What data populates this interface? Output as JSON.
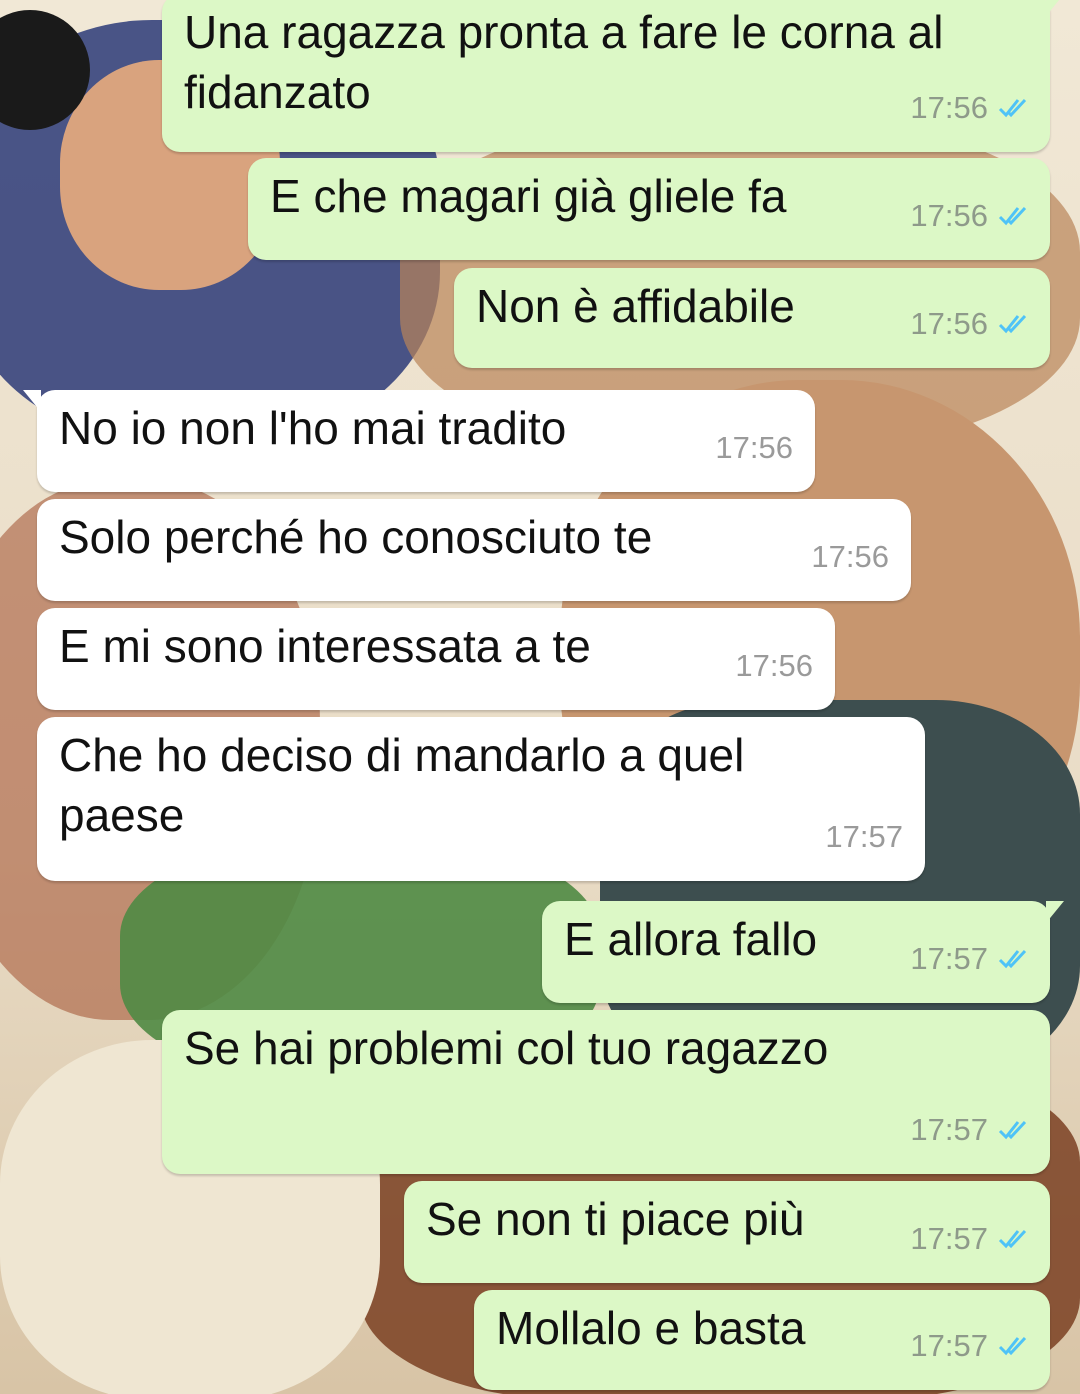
{
  "colors": {
    "outgoing_bubble": "#dcf8c6",
    "incoming_bubble": "#ffffff",
    "read_ticks": "#4fc3f7",
    "timestamp": "#8e9a8a"
  },
  "messages": [
    {
      "direction": "out",
      "text": "Una ragazza pronta a fare le corna al\nfidanzato",
      "time": "17:56",
      "status": "read-double-check-icon"
    },
    {
      "direction": "out",
      "text": "E che magari già gliele fa",
      "time": "17:56",
      "status": "read-double-check-icon"
    },
    {
      "direction": "out",
      "text": "Non è affidabile",
      "time": "17:56",
      "status": "read-double-check-icon"
    },
    {
      "direction": "in",
      "text": "No io non l'ho mai tradito",
      "time": "17:56"
    },
    {
      "direction": "in",
      "text": "Solo perché ho conosciuto te",
      "time": "17:56"
    },
    {
      "direction": "in",
      "text": "E mi sono interessata a te",
      "time": "17:56"
    },
    {
      "direction": "in",
      "text": "Che ho deciso di mandarlo a quel\npaese",
      "time": "17:57"
    },
    {
      "direction": "out",
      "text": "E allora fallo",
      "time": "17:57",
      "status": "read-double-check-icon"
    },
    {
      "direction": "out",
      "text": "Se hai problemi col tuo ragazzo",
      "time": "17:57",
      "status": "read-double-check-icon"
    },
    {
      "direction": "out",
      "text": "Se non ti piace più",
      "time": "17:57",
      "status": "read-double-check-icon"
    },
    {
      "direction": "out",
      "text": "Mollalo e basta",
      "time": "17:57",
      "status": "read-double-check-icon"
    }
  ]
}
